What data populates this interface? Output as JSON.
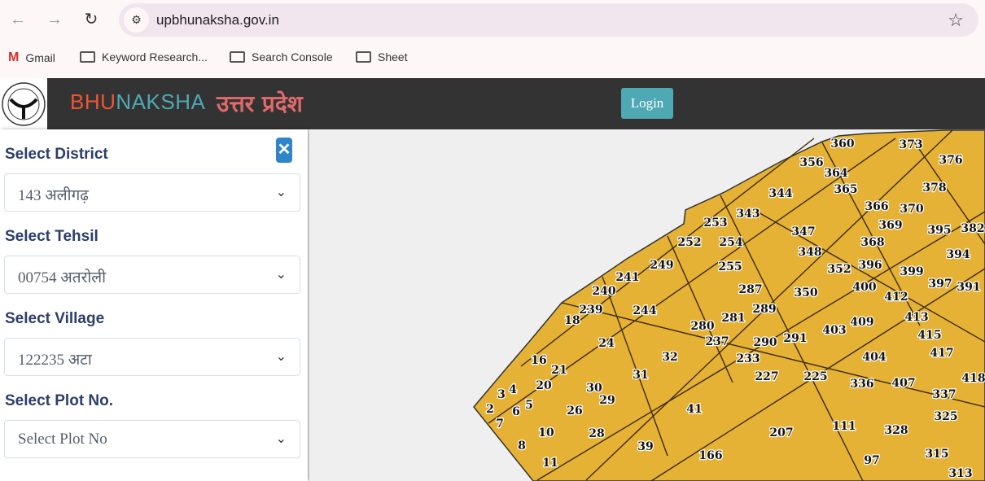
{
  "browser": {
    "url": "upbhunaksha.gov.in",
    "bookmarks": [
      "Gmail",
      "Keyword Research...",
      "Search Console",
      "Sheet"
    ]
  },
  "header": {
    "brand_a": "BHU",
    "brand_b": "NAKSHA",
    "state": "उत्तर प्रदेश",
    "login": "Login",
    "colors": {
      "brand_a": "#f0562f",
      "brand_b": "#4fa9b5",
      "state": "#e26a6a"
    }
  },
  "sidebar": {
    "fields": [
      {
        "label": "Select District",
        "value": "143 अलीगढ़"
      },
      {
        "label": "Select Tehsil",
        "value": "00754 अतरोली"
      },
      {
        "label": "Select Village",
        "value": "122235 अटा"
      },
      {
        "label": "Select Plot No.",
        "value": "Select Plot No"
      }
    ]
  },
  "map": {
    "fill": "#e6b236",
    "plots": [
      "373",
      "360",
      "356",
      "364",
      "376",
      "344",
      "365",
      "366",
      "378",
      "370",
      "343",
      "253",
      "369",
      "395",
      "382",
      "347",
      "252",
      "254",
      "255",
      "348",
      "368",
      "352",
      "396",
      "394",
      "399",
      "249",
      "241",
      "240",
      "287",
      "350",
      "400",
      "412",
      "391",
      "397",
      "239",
      "244",
      "289",
      "281",
      "18",
      "280",
      "409",
      "413",
      "291",
      "24",
      "237",
      "290",
      "415",
      "403",
      "417",
      "16",
      "21",
      "32",
      "233",
      "404",
      "20",
      "31",
      "227",
      "225",
      "336",
      "407",
      "418",
      "4",
      "3",
      "2",
      "30",
      "29",
      "26",
      "41",
      "337",
      "5",
      "6",
      "7",
      "325",
      "111",
      "328",
      "207",
      "28",
      "10",
      "8",
      "39",
      "166",
      "315",
      "11",
      "97",
      "313"
    ]
  }
}
